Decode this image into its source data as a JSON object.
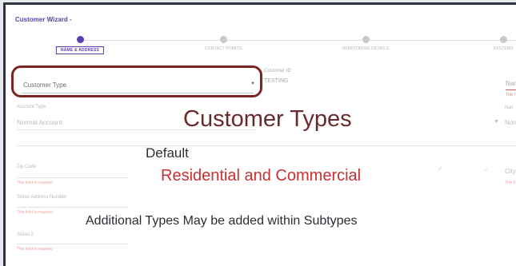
{
  "wizard": {
    "title": "Customer Wizard -"
  },
  "steps": [
    {
      "label": "NAME & ADDRESS"
    },
    {
      "label": "CONTACT POINTS"
    },
    {
      "label": "MONITORING DETAILS"
    },
    {
      "label": "SYSTEMS"
    }
  ],
  "form": {
    "customer_type": {
      "value": "Customer Type"
    },
    "customer_id": {
      "label": "Customer ID",
      "value": "TESTING"
    },
    "name_cut": {
      "label": "Nan",
      "error": "This f"
    },
    "account_type": {
      "label": "Account Type",
      "value": "Normal Account"
    },
    "right_field_cut": {
      "label": "Nav",
      "value": "Non"
    },
    "zip": {
      "label": "Zip Code",
      "error": "This field is required"
    },
    "city_cut": {
      "label": "City",
      "error": "This fi"
    },
    "street": {
      "label": "Street Address Number",
      "error": "This field is required"
    },
    "street2": {
      "label": "Street 2",
      "error": "This field is required"
    }
  },
  "overlay": {
    "title": "Customer Types",
    "default_label": "Default",
    "types_text": "Residential and Commercial",
    "note": "Additional Types May be added within Subtypes"
  },
  "colors": {
    "accent": "#5b3fae",
    "highlight_border": "#7b2424",
    "title_text": "#6a2a2d",
    "types_text": "#c63133"
  }
}
